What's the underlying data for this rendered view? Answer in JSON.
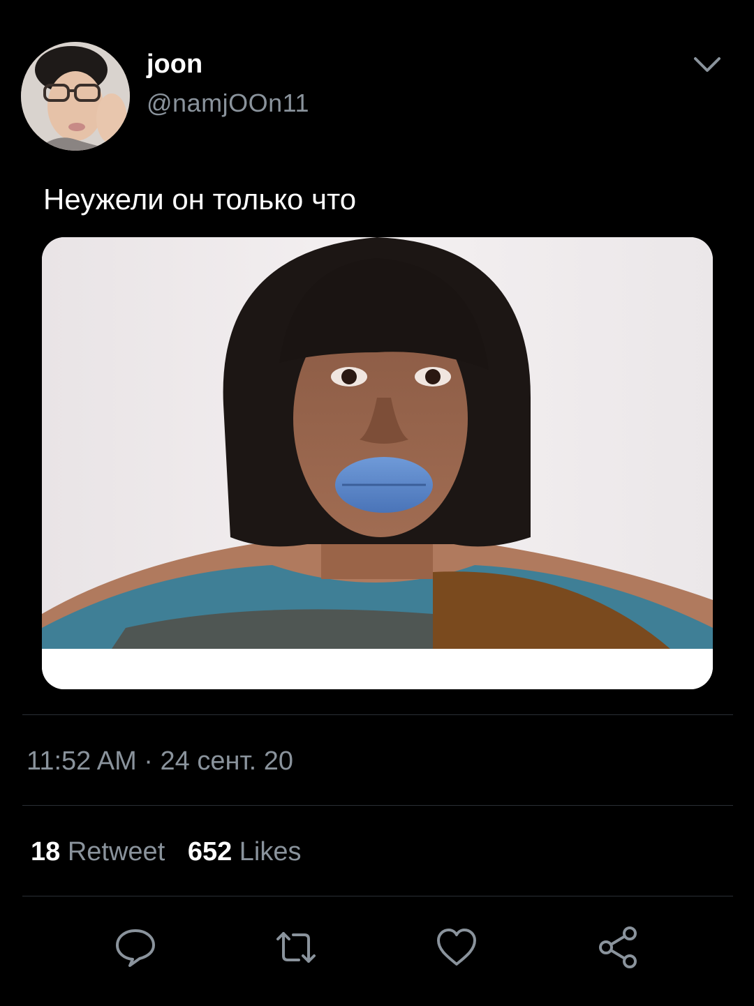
{
  "author": {
    "display_name": "joon",
    "handle": "@namjOOn11"
  },
  "tweet": {
    "text": "Неужели он только что",
    "timestamp": "11:52 AM · 24 сент. 20"
  },
  "stats": {
    "retweets_count": "18",
    "retweets_label": "Retweet",
    "likes_count": "652",
    "likes_label": "Likes"
  },
  "icons": {
    "menu": "chevron-down-icon",
    "reply": "reply-icon",
    "retweet": "retweet-icon",
    "like": "heart-icon",
    "share": "share-icon"
  },
  "colors": {
    "background": "#000000",
    "text_primary": "#ffffff",
    "text_secondary": "#8a939c",
    "divider": "#2a2f35",
    "icon": "#8a939c"
  }
}
